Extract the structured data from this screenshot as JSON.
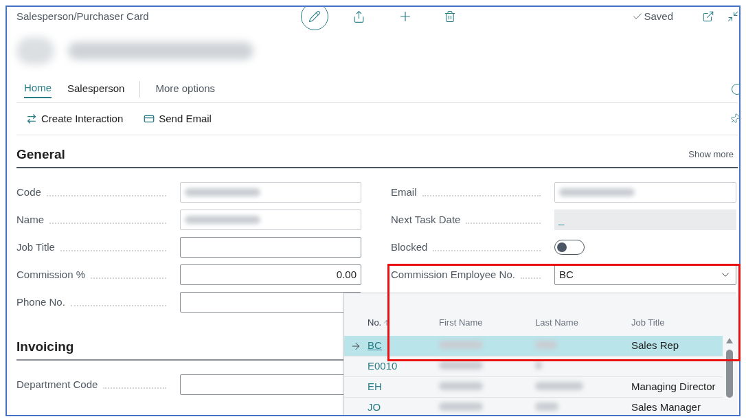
{
  "page": {
    "title": "Salesperson/Purchaser Card",
    "status": "Saved"
  },
  "tabs": [
    {
      "label": "Home",
      "selected": true
    },
    {
      "label": "Salesperson",
      "selected": false
    },
    {
      "label": "More options",
      "selected": false
    }
  ],
  "actions": [
    {
      "label": "Create Interaction",
      "kind": "interaction"
    },
    {
      "label": "Send Email",
      "kind": "email"
    }
  ],
  "general": {
    "title": "General",
    "show_more": "Show more",
    "left_fields": [
      {
        "label": "Code",
        "kind": "redacted"
      },
      {
        "label": "Name",
        "kind": "redacted"
      },
      {
        "label": "Job Title",
        "kind": "input"
      },
      {
        "label": "Commission %",
        "kind": "number",
        "value": "0.00"
      },
      {
        "label": "Phone No.",
        "kind": "input"
      }
    ],
    "right_fields": [
      {
        "label": "Email",
        "kind": "redacted"
      },
      {
        "label": "Next Task Date",
        "kind": "disabled",
        "value": "_"
      },
      {
        "label": "Blocked",
        "kind": "toggle",
        "on": false
      },
      {
        "label": "Commission Employee No.",
        "kind": "select",
        "value": "BC"
      }
    ]
  },
  "invoicing": {
    "title": "Invoicing",
    "fields": [
      {
        "label": "Department Code",
        "kind": "input"
      }
    ]
  },
  "lookup": {
    "columns": [
      {
        "label": "No.",
        "sorted": true
      },
      {
        "label": "First Name",
        "sorted": false
      },
      {
        "label": "Last Name",
        "sorted": false
      },
      {
        "label": "Job Title",
        "sorted": false
      }
    ],
    "rows": [
      {
        "no": "BC",
        "job_title": "Sales Rep",
        "selected": true
      },
      {
        "no": "E0010",
        "selected": false
      },
      {
        "no": "EH",
        "job_title": "Managing Director",
        "selected": false
      },
      {
        "no": "JO",
        "job_title": "Sales Manager",
        "selected": false
      }
    ]
  }
}
